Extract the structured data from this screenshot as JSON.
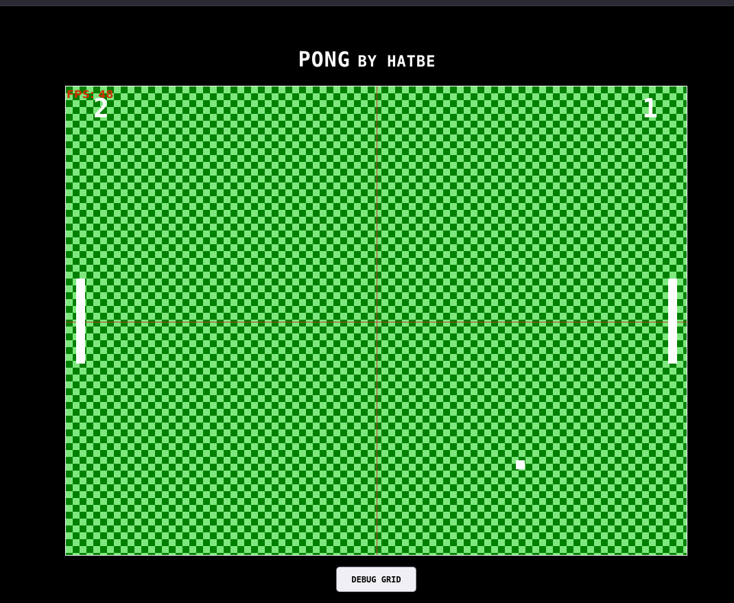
{
  "header": {
    "title_main": "PONG",
    "title_byline": "BY HATBE"
  },
  "game": {
    "fps_text": "FPS: 48",
    "score_left": "2",
    "score_right": "1",
    "colors": {
      "field_dark": "#008000",
      "field_light": "#7ee87e",
      "grid_line": "#c0392b",
      "paddle": "#ffffff",
      "ball": "#ffffff"
    }
  },
  "controls": {
    "debug_grid_label": "DEBUG GRID"
  }
}
